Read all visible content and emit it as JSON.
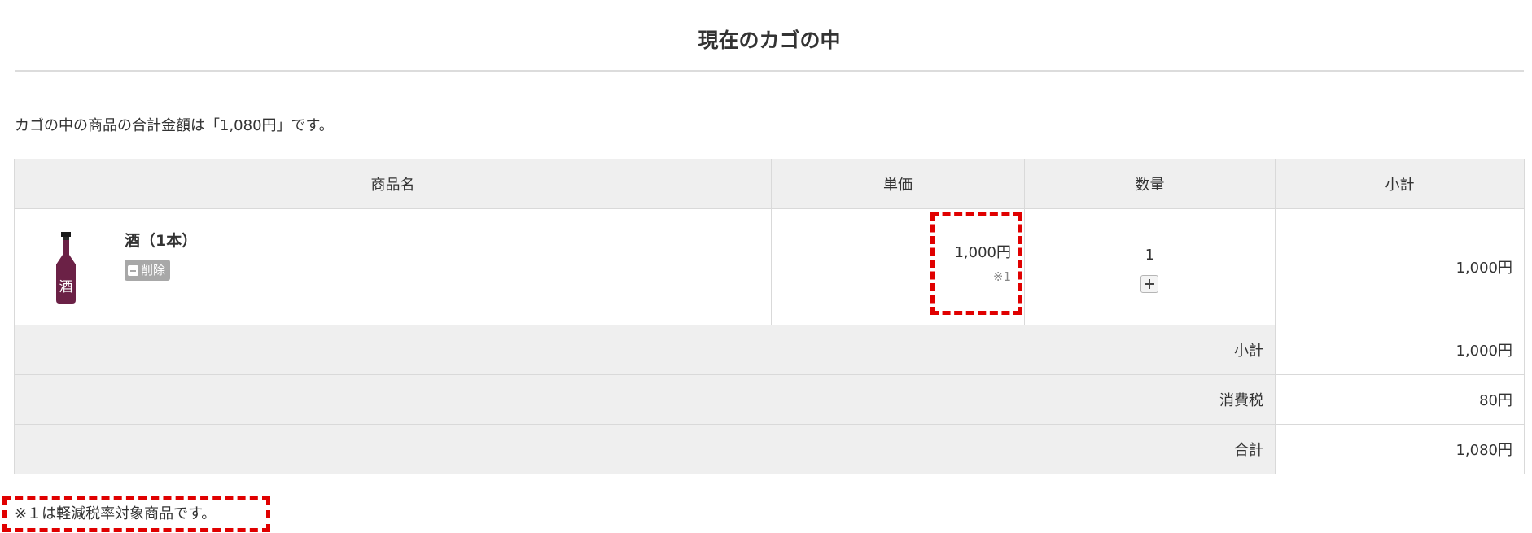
{
  "page": {
    "title": "現在のカゴの中",
    "summary": "カゴの中の商品の合計金額は「1,080円」です。"
  },
  "table": {
    "headers": {
      "product": "商品名",
      "unit_price": "単価",
      "quantity": "数量",
      "subtotal": "小計"
    },
    "item": {
      "name": "酒（1本）",
      "delete_label": "削除",
      "bottle_label": "酒",
      "unit_price": "1,000円",
      "price_note": "※1",
      "quantity": "1",
      "subtotal": "1,000円"
    },
    "totals": [
      {
        "label": "小計",
        "value": "1,000円"
      },
      {
        "label": "消費税",
        "value": "80円"
      },
      {
        "label": "合計",
        "value": "1,080円"
      }
    ]
  },
  "footnote": "※１は軽減税率対象商品です。",
  "colors": {
    "highlight": "#e00000",
    "header_bg": "#efefef",
    "bottle": "#6b2146",
    "delete_button": "#a8a8a8"
  },
  "icons": {
    "delete": "minus-square-icon",
    "increase_quantity": "plus-square-icon",
    "product_image": "sake-bottle-icon"
  }
}
